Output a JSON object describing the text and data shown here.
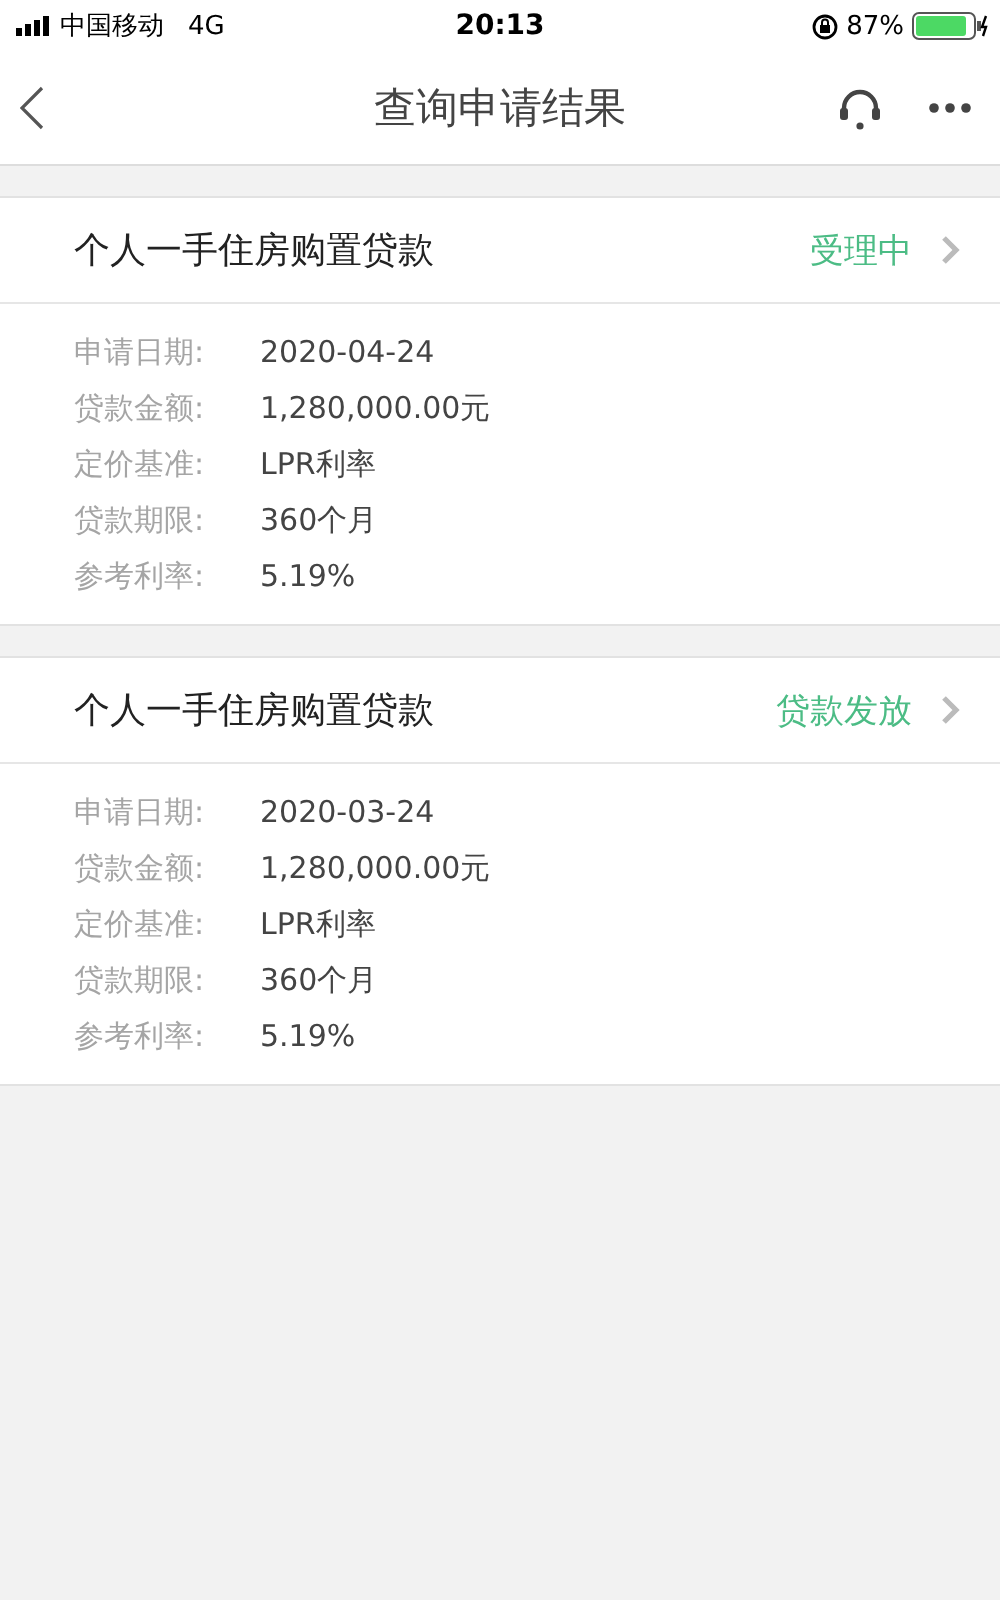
{
  "status_bar": {
    "carrier": "中国移动",
    "network": "4G",
    "time": "20:13",
    "battery": "87%"
  },
  "header": {
    "title": "查询申请结果"
  },
  "applications": [
    {
      "title": "个人一手住房购置贷款",
      "status": "受理中",
      "fields": [
        {
          "label": "申请日期:",
          "value": "2020-04-24"
        },
        {
          "label": "贷款金额:",
          "value": "1,280,000.00元"
        },
        {
          "label": "定价基准:",
          "value": "LPR利率"
        },
        {
          "label": "贷款期限:",
          "value": "360个月"
        },
        {
          "label": "参考利率:",
          "value": "5.19%"
        }
      ]
    },
    {
      "title": "个人一手住房购置贷款",
      "status": "贷款发放",
      "fields": [
        {
          "label": "申请日期:",
          "value": "2020-03-24"
        },
        {
          "label": "贷款金额:",
          "value": "1,280,000.00元"
        },
        {
          "label": "定价基准:",
          "value": "LPR利率"
        },
        {
          "label": "贷款期限:",
          "value": "360个月"
        },
        {
          "label": "参考利率:",
          "value": "5.19%"
        }
      ]
    }
  ]
}
